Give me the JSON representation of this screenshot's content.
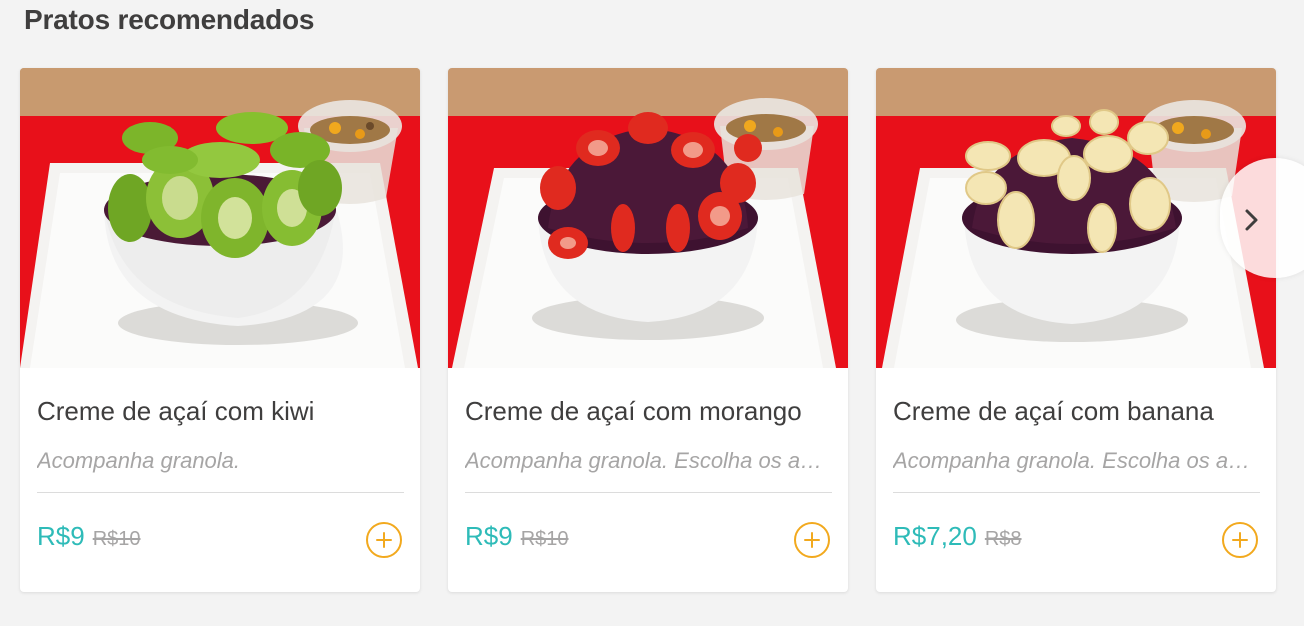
{
  "section": {
    "title": "Pratos recomendados"
  },
  "colors": {
    "price": "#2ebbb8",
    "add_button": "#f2a91e",
    "muted": "#a6a5a5",
    "text": "#3f3e3e"
  },
  "icons": {
    "add": "plus-circle-icon",
    "next": "chevron-right-icon"
  },
  "dishes": [
    {
      "name": "Creme de açaí com kiwi",
      "description": "Acompanha granola.",
      "price": "R$9",
      "old_price": "R$10",
      "topping": "kiwi"
    },
    {
      "name": "Creme de açaí com morango",
      "description": "Acompanha granola. Escolha os adicionais",
      "price": "R$9",
      "old_price": "R$10",
      "topping": "morango"
    },
    {
      "name": "Creme de açaí com banana",
      "description": "Acompanha granola. Escolha os adicionais",
      "price": "R$7,20",
      "old_price": "R$8",
      "topping": "banana"
    }
  ]
}
